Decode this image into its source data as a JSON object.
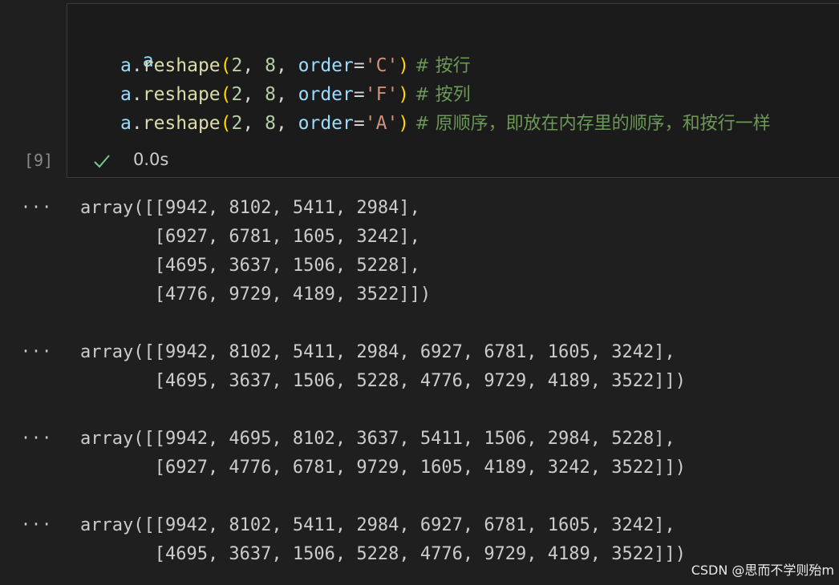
{
  "cell": {
    "code_lines": [
      {
        "var": "a",
        "rest": ""
      },
      {
        "var": "a",
        "dot": ".",
        "fn": "reshape",
        "open": "(",
        "n1": "2",
        "sep1": ", ",
        "n2": "8",
        "sep2": ", ",
        "kw": "order",
        "eq": "=",
        "str": "'C'",
        "close": ")",
        "comment": " # 按行"
      },
      {
        "var": "a",
        "dot": ".",
        "fn": "reshape",
        "open": "(",
        "n1": "2",
        "sep1": ", ",
        "n2": "8",
        "sep2": ", ",
        "kw": "order",
        "eq": "=",
        "str": "'F'",
        "close": ")",
        "comment": " # 按列"
      },
      {
        "var": "a",
        "dot": ".",
        "fn": "reshape",
        "open": "(",
        "n1": "2",
        "sep1": ", ",
        "n2": "8",
        "sep2": ", ",
        "kw": "order",
        "eq": "=",
        "str": "'A'",
        "close": ")",
        "comment": " # 原顺序，即放在内存里的顺序，和按行一样"
      }
    ],
    "exec_count": "[9]",
    "exec_time": "0.0s"
  },
  "outputs": [
    {
      "dots": "···",
      "lines": [
        "array([[9942, 8102, 5411, 2984],",
        "       [6927, 6781, 1605, 3242],",
        "       [4695, 3637, 1506, 5228],",
        "       [4776, 9729, 4189, 3522]])"
      ]
    },
    {
      "dots": "···",
      "lines": [
        "array([[9942, 8102, 5411, 2984, 6927, 6781, 1605, 3242],",
        "       [4695, 3637, 1506, 5228, 4776, 9729, 4189, 3522]])"
      ]
    },
    {
      "dots": "···",
      "lines": [
        "array([[9942, 4695, 8102, 3637, 5411, 1506, 2984, 5228],",
        "       [6927, 4776, 6781, 9729, 1605, 4189, 3242, 3522]])"
      ]
    },
    {
      "dots": "···",
      "lines": [
        "array([[9942, 8102, 5411, 2984, 6927, 6781, 1605, 3242],",
        "       [4695, 3637, 1506, 5228, 4776, 9729, 4189, 3522]])"
      ]
    }
  ],
  "watermark": "CSDN @思而不学则殆m",
  "icons": {
    "status": "check-icon"
  },
  "colors": {
    "check": "#73c991"
  }
}
